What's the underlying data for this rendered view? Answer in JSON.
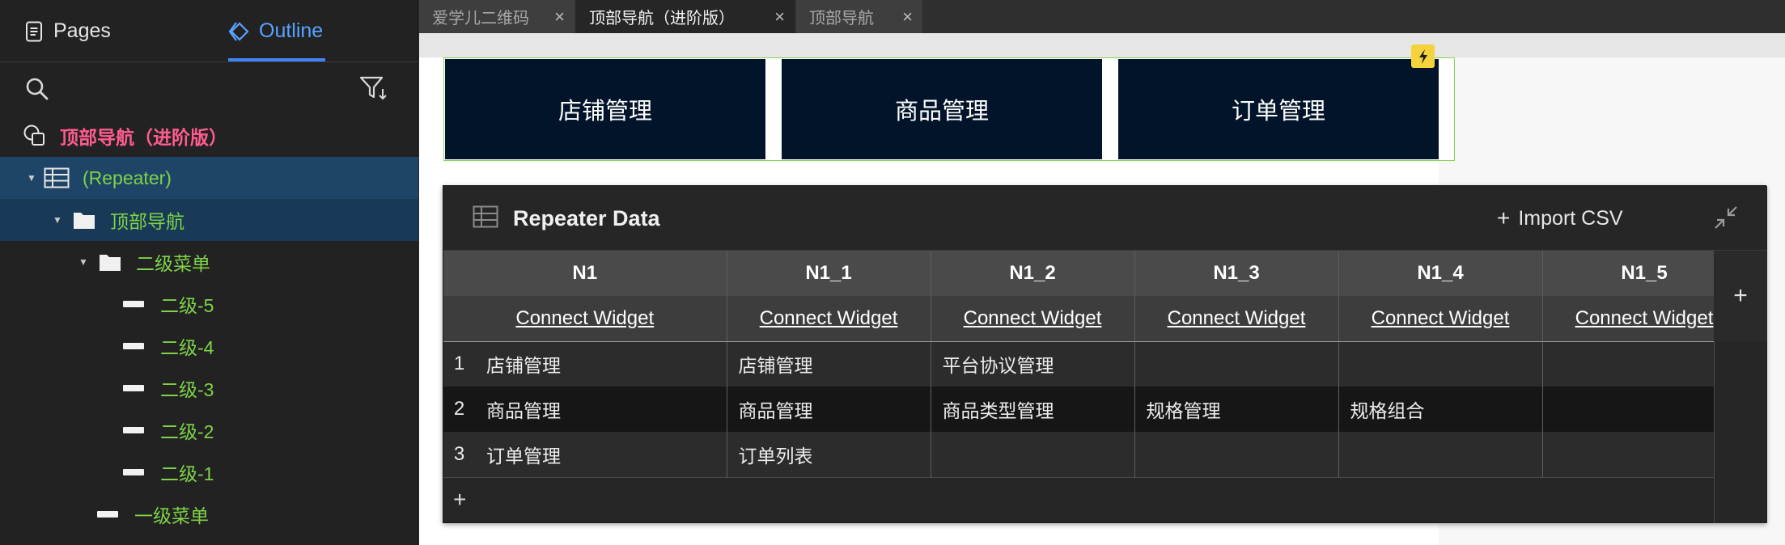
{
  "left_panel": {
    "tabs": {
      "pages": "Pages",
      "outline": "Outline"
    },
    "tree": {
      "page": "顶部导航（进阶版）",
      "repeater": "(Repeater)",
      "folder_top": "顶部导航",
      "folder_sub": "二级菜单",
      "items": [
        "二级-5",
        "二级-4",
        "二级-3",
        "二级-2",
        "二级-1"
      ],
      "level1": "一级菜单"
    }
  },
  "doc_tabs": [
    {
      "label": "爱学儿二维码",
      "active": false
    },
    {
      "label": "顶部导航（进阶版）",
      "active": true
    },
    {
      "label": "顶部导航",
      "active": false
    }
  ],
  "canvas": {
    "nav": [
      "店铺管理",
      "商品管理",
      "订单管理"
    ]
  },
  "repeater_data": {
    "title": "Repeater Data",
    "import_label": "Import CSV",
    "columns": [
      "N1",
      "N1_1",
      "N1_2",
      "N1_3",
      "N1_4",
      "N1_5"
    ],
    "connect_label": "Connect Widget",
    "rows": [
      {
        "num": "1",
        "cells": [
          "店铺管理",
          "店铺管理",
          "平台协议管理",
          "",
          "",
          ""
        ]
      },
      {
        "num": "2",
        "cells": [
          "商品管理",
          "商品管理",
          "商品类型管理",
          "规格管理",
          "规格组合",
          ""
        ]
      },
      {
        "num": "3",
        "cells": [
          "订单管理",
          "订单列表",
          "",
          "",
          "",
          ""
        ]
      }
    ]
  },
  "colors": {
    "accent_blue": "#3d85f2",
    "tree_green": "#7fd348",
    "page_pink": "#ff5c8d",
    "nav_bg": "#02142a",
    "selection": "#1e4567",
    "lightning": "#f4d33c"
  }
}
